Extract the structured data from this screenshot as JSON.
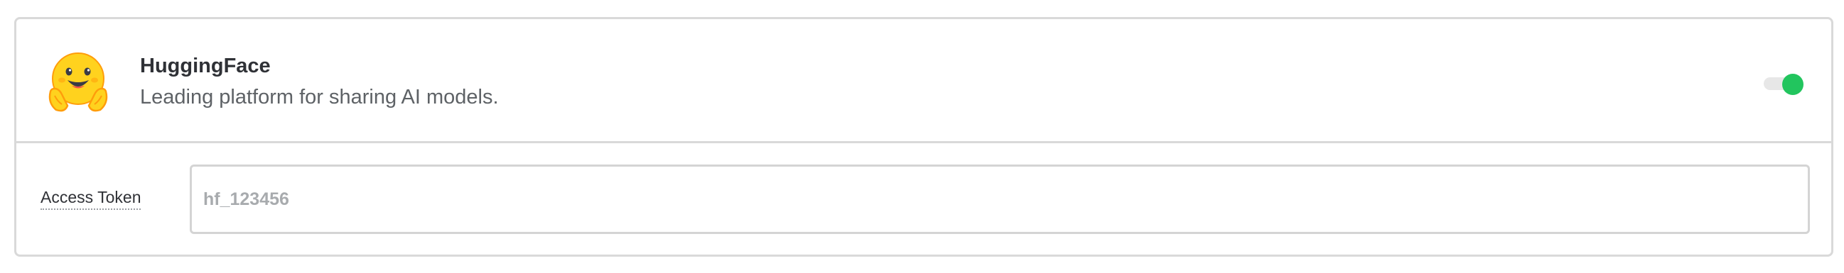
{
  "provider": {
    "name": "HuggingFace",
    "description": "Leading platform for sharing AI models.",
    "logo_icon": "hugging-face-emoji-icon",
    "enabled": true,
    "toggle_on_color": "#22c55e"
  },
  "settings": {
    "access_token": {
      "label": "Access Token",
      "value": "",
      "placeholder": "hf_123456"
    }
  }
}
